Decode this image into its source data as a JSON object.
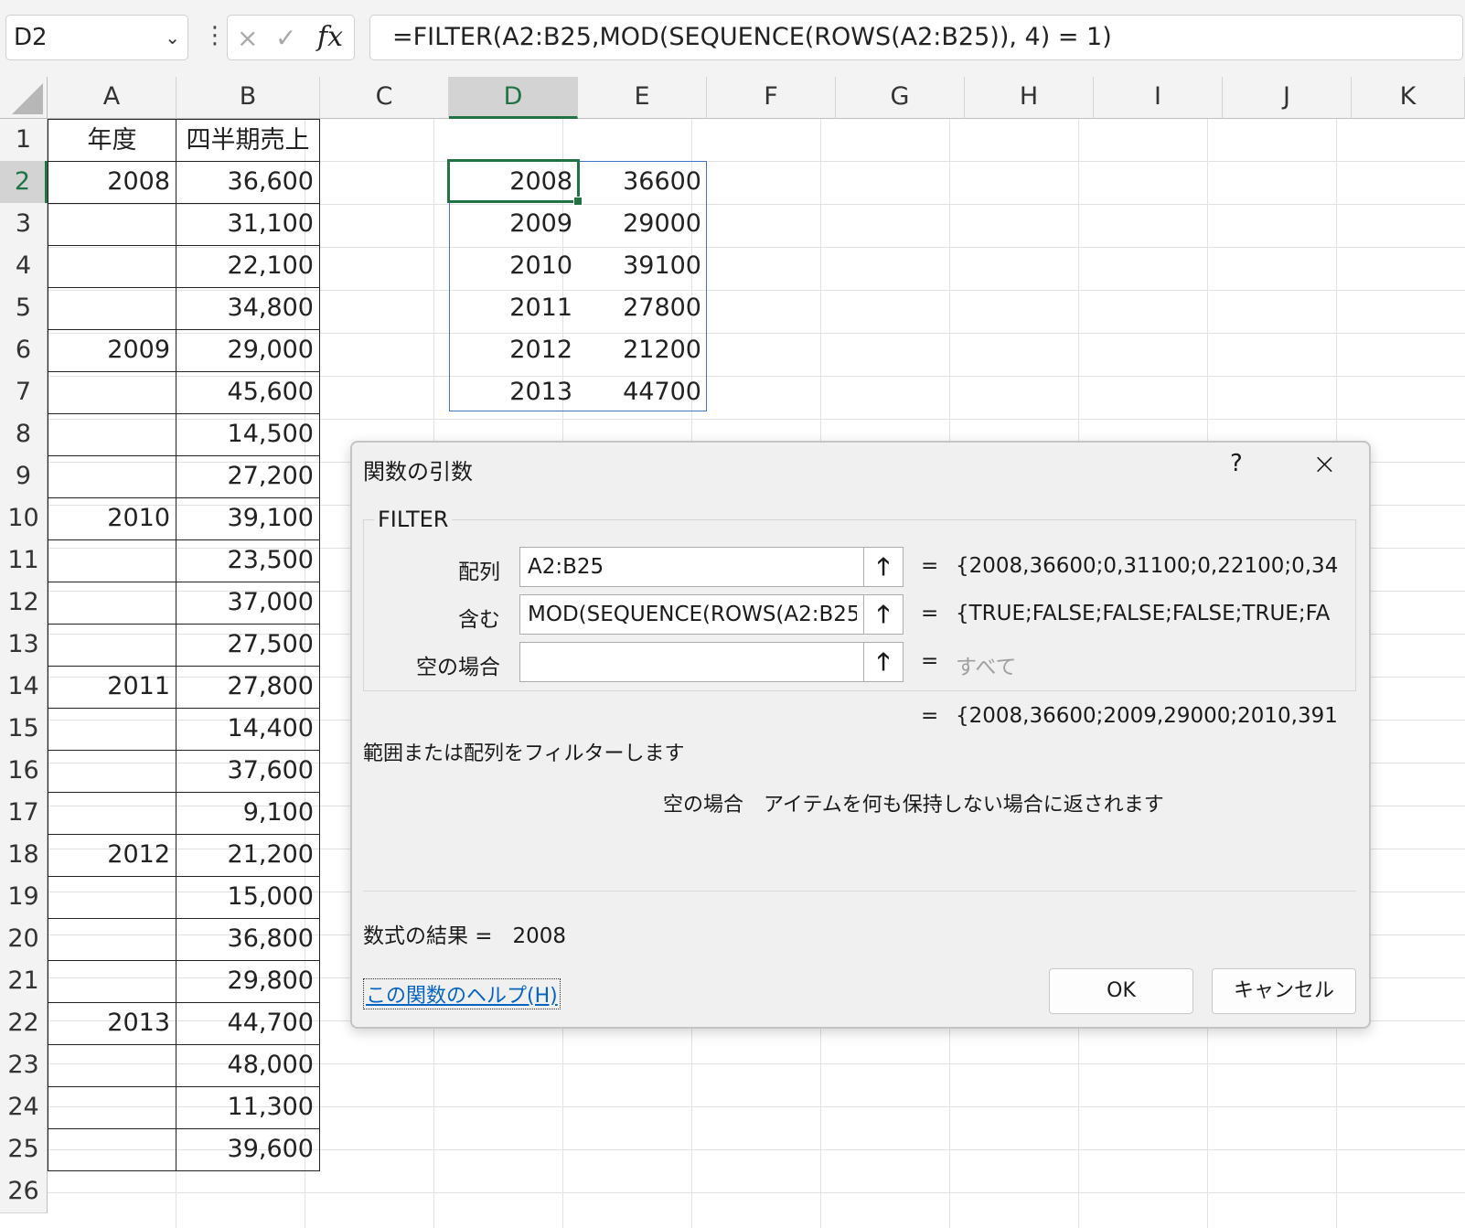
{
  "formula_bar": {
    "name_box": "D2",
    "cancel_icon": "×",
    "enter_icon": "✓",
    "fx_label": "fx",
    "formula": "=FILTER(A2:B25,MOD(SEQUENCE(ROWS(A2:B25)), 4) = 1)"
  },
  "columns": [
    "A",
    "B",
    "C",
    "D",
    "E",
    "F",
    "G",
    "H",
    "I",
    "J",
    "K"
  ],
  "selected_column": "D",
  "rows": [
    "1",
    "2",
    "3",
    "4",
    "5",
    "6",
    "7",
    "8",
    "9",
    "10",
    "11",
    "12",
    "13",
    "14",
    "15",
    "16",
    "17",
    "18",
    "19",
    "20",
    "21",
    "22",
    "23",
    "24",
    "25",
    "26"
  ],
  "selected_row": "2",
  "headers": {
    "a1": "年度",
    "b1": "四半期売上"
  },
  "col_a": [
    "2008",
    "",
    "",
    "",
    "2009",
    "",
    "",
    "",
    "2010",
    "",
    "",
    "",
    "2011",
    "",
    "",
    "",
    "2012",
    "",
    "",
    "",
    "2013",
    "",
    "",
    ""
  ],
  "col_b": [
    "36,600",
    "31,100",
    "22,100",
    "34,800",
    "29,000",
    "45,600",
    "14,500",
    "27,200",
    "39,100",
    "23,500",
    "37,000",
    "27,500",
    "27,800",
    "14,400",
    "37,600",
    "9,100",
    "21,200",
    "15,000",
    "36,800",
    "29,800",
    "44,700",
    "48,000",
    "11,300",
    "39,600"
  ],
  "spill": {
    "years": [
      "2008",
      "2009",
      "2010",
      "2011",
      "2012",
      "2013"
    ],
    "sales": [
      "36600",
      "29000",
      "39100",
      "27800",
      "21200",
      "44700"
    ]
  },
  "dialog": {
    "title": "関数の引数",
    "help_icon": "?",
    "close_icon": "×",
    "function_name": "FILTER",
    "args": [
      {
        "label": "配列",
        "value": "A2:B25",
        "eq": "=",
        "result": "{2008,36600;0,31100;0,22100;0,34"
      },
      {
        "label": "含む",
        "value": "MOD(SEQUENCE(ROWS(A2:B25",
        "eq": "=",
        "result": "{TRUE;FALSE;FALSE;FALSE;TRUE;FA"
      },
      {
        "label": "空の場合",
        "value": "",
        "eq": "=",
        "result": "すべて"
      }
    ],
    "overall_eq": "=",
    "overall_result": "{2008,36600;2009,29000;2010,391",
    "description": "範囲または配列をフィルターします",
    "arg_description": "空の場合　アイテムを何も保持しない場合に返されます",
    "formula_result": "数式の結果 =   2008",
    "help_link": "この関数のヘルプ(H)",
    "ok": "OK",
    "cancel": "キャンセル"
  }
}
